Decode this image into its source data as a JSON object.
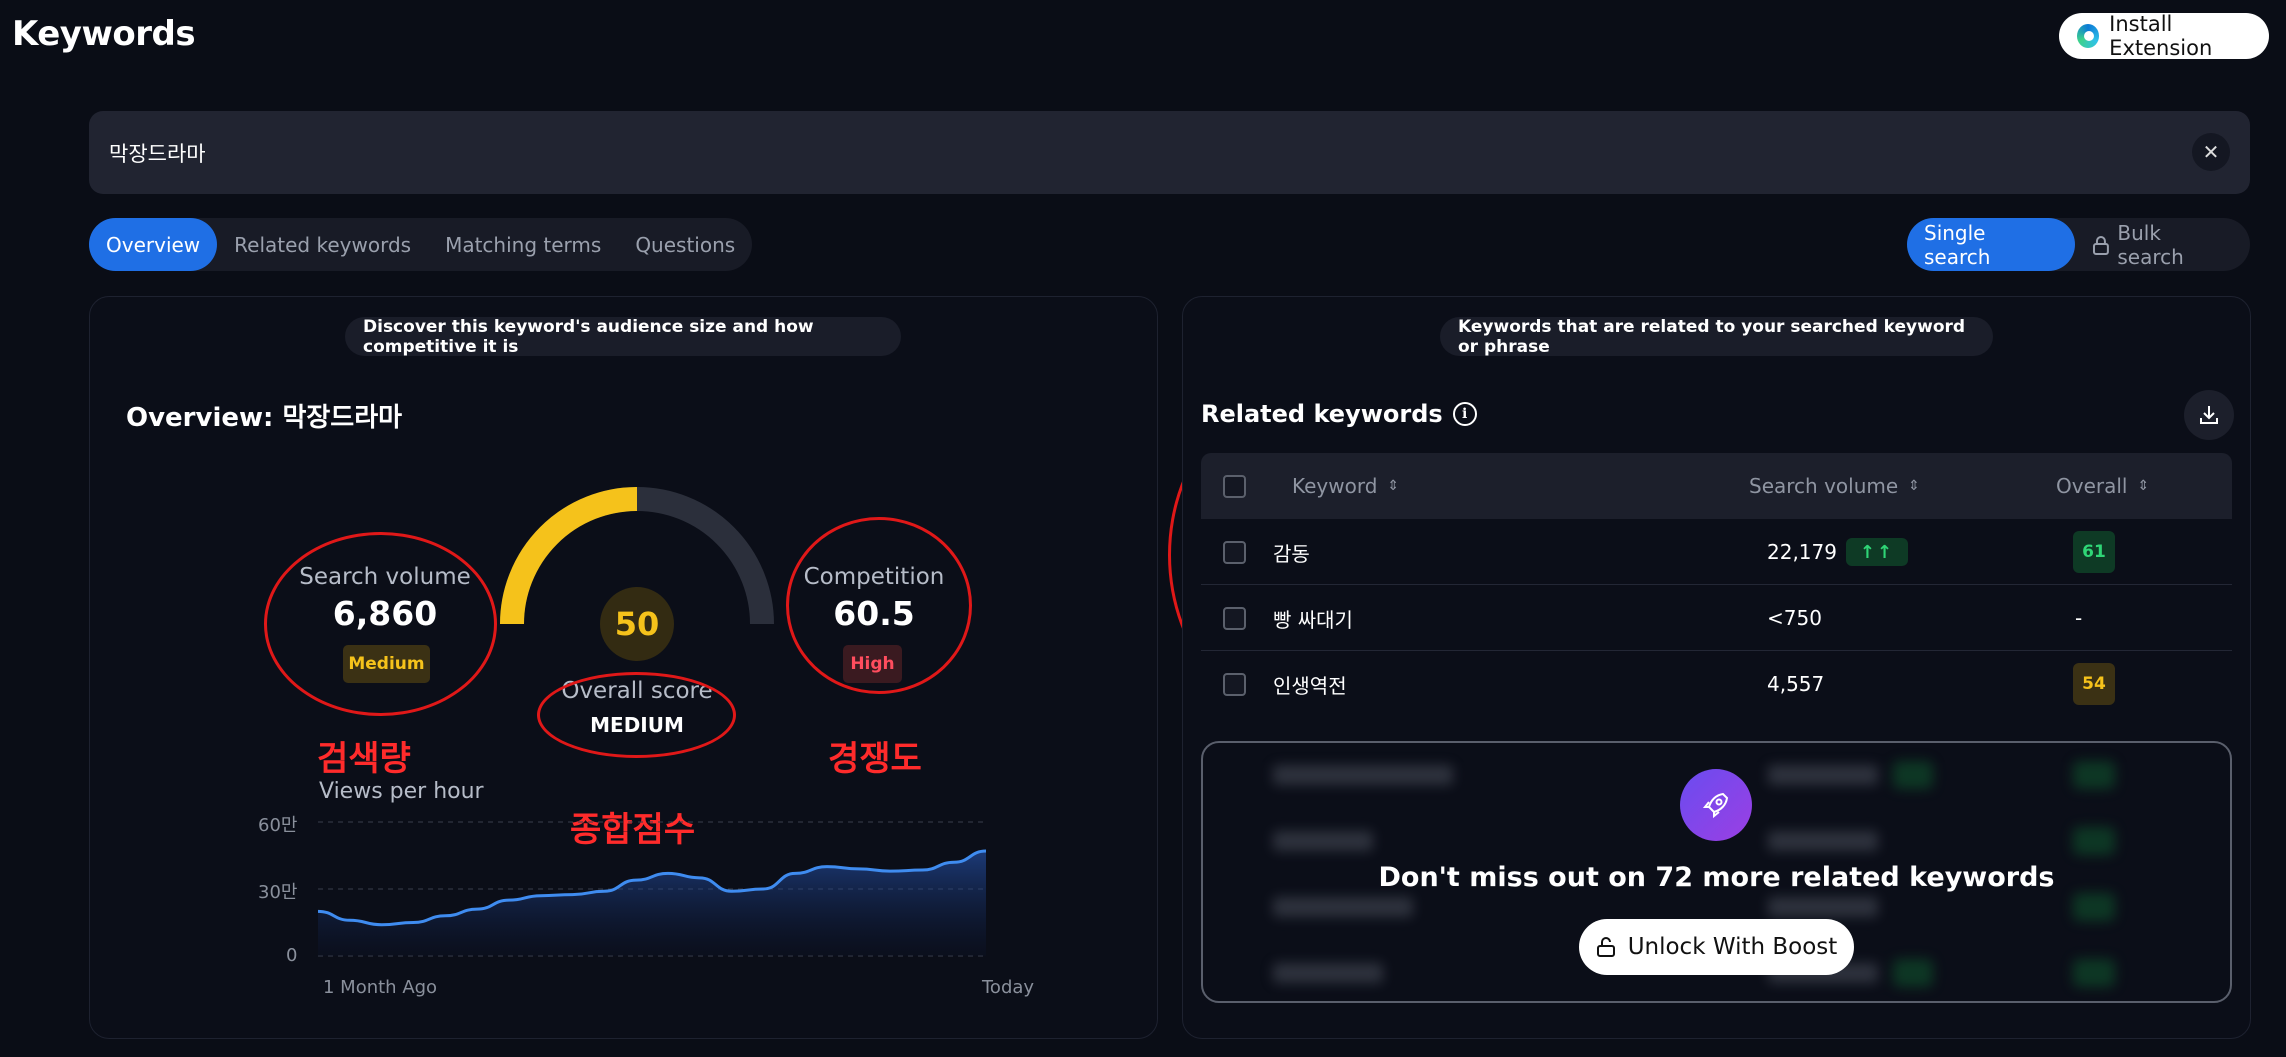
{
  "header": {
    "title": "Keywords",
    "install_label": "Install Extension"
  },
  "search": {
    "value": "막장드라마"
  },
  "tabs": [
    {
      "label": "Overview",
      "active": true
    },
    {
      "label": "Related keywords",
      "active": false
    },
    {
      "label": "Matching terms",
      "active": false
    },
    {
      "label": "Questions",
      "active": false
    }
  ],
  "modes": {
    "single": "Single search",
    "bulk": "Bulk search"
  },
  "overview": {
    "note": "Discover this keyword's audience size and how competitive it is",
    "title": "Overview: 막장드라마",
    "search_volume": {
      "label": "Search volume",
      "value": "6,860",
      "badge": "Medium"
    },
    "competition": {
      "label": "Competition",
      "value": "60.5",
      "badge": "High"
    },
    "overall": {
      "score": "50",
      "label": "Overall score",
      "level": "MEDIUM",
      "fraction": 0.5
    },
    "annotations": {
      "volume": "검색량",
      "score": "종합점수",
      "competition": "경쟁도"
    }
  },
  "chart_data": {
    "type": "area",
    "title": "Views per hour",
    "y_ticks": [
      "60만",
      "30만",
      "0"
    ],
    "ylim": [
      0,
      600000
    ],
    "x_labels": [
      "1 Month Ago",
      "Today"
    ],
    "values": [
      200000,
      160000,
      140000,
      150000,
      180000,
      210000,
      250000,
      270000,
      275000,
      290000,
      340000,
      370000,
      350000,
      290000,
      300000,
      370000,
      400000,
      390000,
      380000,
      385000,
      420000,
      470000
    ]
  },
  "related": {
    "note": "Keywords that are related to your searched keyword or phrase",
    "title": "Related keywords",
    "columns": {
      "keyword": "Keyword",
      "volume": "Search volume",
      "overall": "Overall"
    },
    "rows": [
      {
        "keyword": "감동",
        "volume": "22,179",
        "trend": "↑↑",
        "overall": "61"
      },
      {
        "keyword": "빵 싸대기",
        "volume": "<750",
        "trend": "",
        "overall": "-"
      },
      {
        "keyword": "인생역전",
        "volume": "4,557",
        "trend": "",
        "overall": "54"
      }
    ],
    "locked_message": "Don't miss out on 72 more related keywords",
    "unlock_label": "Unlock With Boost"
  },
  "colors": {
    "accent": "#1f6fe5",
    "gauge": "#f5c21b",
    "high": "#ff4d5e",
    "green": "#2fd576"
  }
}
